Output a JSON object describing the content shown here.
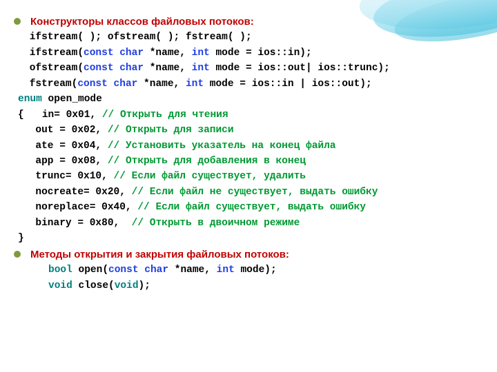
{
  "heading1": "Конструкторы классов файловых потоков:",
  "heading2": "Методы открытия и закрытия файловых потоков:",
  "l1": " ifstream( ); ofstream( ); fstream( );",
  "sig_if": {
    "pre": " ifstream(",
    "kw": "const char",
    "mid": " *name, ",
    "kw2": "int",
    "post": " mode = ios::in);"
  },
  "sig_of": {
    "pre": " ofstream(",
    "kw": "const char",
    "mid": " *name, ",
    "kw2": "int",
    "post": " mode = ios::out| ios::trunc);"
  },
  "sig_fs": {
    "pre": " fstream(",
    "kw": "const char",
    "mid": " *name, ",
    "kw2": "int",
    "post": " mode = ios::in | ios::out);"
  },
  "enum_kw": "enum",
  "enum_name": " open_mode",
  "brace_open": "{   ",
  "modes": {
    "in": {
      "lhs": "in",
      "eq": "= 0x01, ",
      "c": "// Открыть для чтения"
    },
    "out": {
      "lhs": "  out ",
      "eq": "= 0x02, ",
      "c": "// Открыть для записи"
    },
    "ate": {
      "lhs": "  ate ",
      "eq": "= 0x04, ",
      "c": "// Установить указатель на конец файла"
    },
    "app": {
      "lhs": "  app ",
      "eq": "= 0x08, ",
      "c": "// Открыть для добавления в конец"
    },
    "trunc": {
      "lhs": "  trunc",
      "eq": "= 0x10, ",
      "c": "// Если файл существует, удалить"
    },
    "nocreate": {
      "lhs": "  nocreate",
      "eq": "= 0x20, ",
      "c": "// Если файл не существует, выдать ошибку"
    },
    "noreplace": {
      "lhs": "  noreplace",
      "eq": "= 0x40, ",
      "c": "// Если файл существует, выдать ошибку"
    },
    "binary": {
      "lhs": "  binary ",
      "eq": "= 0x80,  ",
      "c": "// Открыть в двоичном режиме"
    }
  },
  "brace_close": "}",
  "open_fn": {
    "ret": "bool",
    "name": " open(",
    "kw": "const char",
    "mid": " *name, ",
    "kw2": "int",
    "post": " mode);"
  },
  "close_fn": {
    "ret": "void",
    "name": " close(",
    "arg": "void",
    "post": ");"
  }
}
